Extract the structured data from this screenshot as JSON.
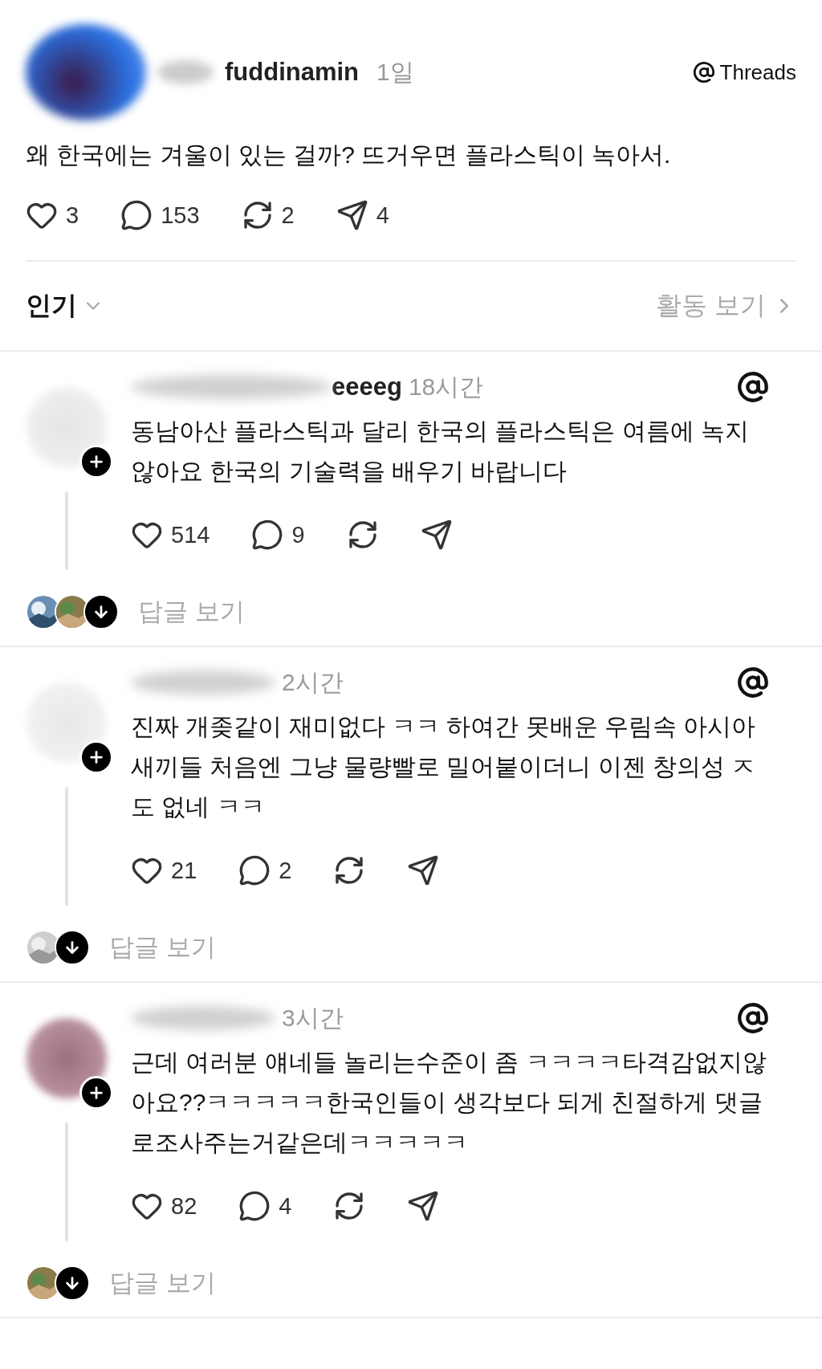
{
  "post": {
    "username": "fuddinamin",
    "time": "1일",
    "brand": "Threads",
    "text": "왜 한국에는 겨울이 있는 걸까? 뜨거우면 플라스틱이 녹아서.",
    "actions": [
      {
        "kind": "like",
        "count": "3"
      },
      {
        "kind": "reply",
        "count": "153"
      },
      {
        "kind": "repost",
        "count": "2"
      },
      {
        "kind": "share",
        "count": "4"
      }
    ]
  },
  "sort": {
    "label": "인기",
    "activity": "활동 보기"
  },
  "comments": [
    {
      "username": "eeeeg",
      "time": "18시간",
      "follow": true,
      "text": "동남아산 플라스틱과 달리 한국의 플라스틱은 여름에 녹지 않아요 한국의 기술력을 배우기 바랍니다",
      "actions": [
        {
          "kind": "like",
          "count": "514"
        },
        {
          "kind": "reply",
          "count": "9"
        },
        {
          "kind": "repost"
        },
        {
          "kind": "share"
        }
      ],
      "view_replies": "답글 보기"
    },
    {
      "time": "2시간",
      "follow": true,
      "text": "진짜 개좆같이 재미없다 ㅋㅋ 하여간 못배운 우림속 아시아 새끼들 처음엔 그냥 물량빨로 밀어붙이더니 이젠 창의성 ㅈ도 없네 ㅋㅋ",
      "actions": [
        {
          "kind": "like",
          "count": "21"
        },
        {
          "kind": "reply",
          "count": "2"
        },
        {
          "kind": "repost"
        },
        {
          "kind": "share"
        }
      ],
      "view_replies": "답글 보기"
    },
    {
      "time": "3시간",
      "follow": true,
      "text": "근데 여러분 얘네들 놀리는수준이 좀 ㅋㅋㅋㅋ타격감없지않아요??ㅋㅋㅋㅋㅋ한국인들이 생각보다 되게 친절하게 댓글로조사주는거같은데ㅋㅋㅋㅋㅋ",
      "actions": [
        {
          "kind": "like",
          "count": "82"
        },
        {
          "kind": "reply",
          "count": "4"
        },
        {
          "kind": "repost"
        },
        {
          "kind": "share"
        }
      ],
      "view_replies": "답글 보기"
    }
  ]
}
